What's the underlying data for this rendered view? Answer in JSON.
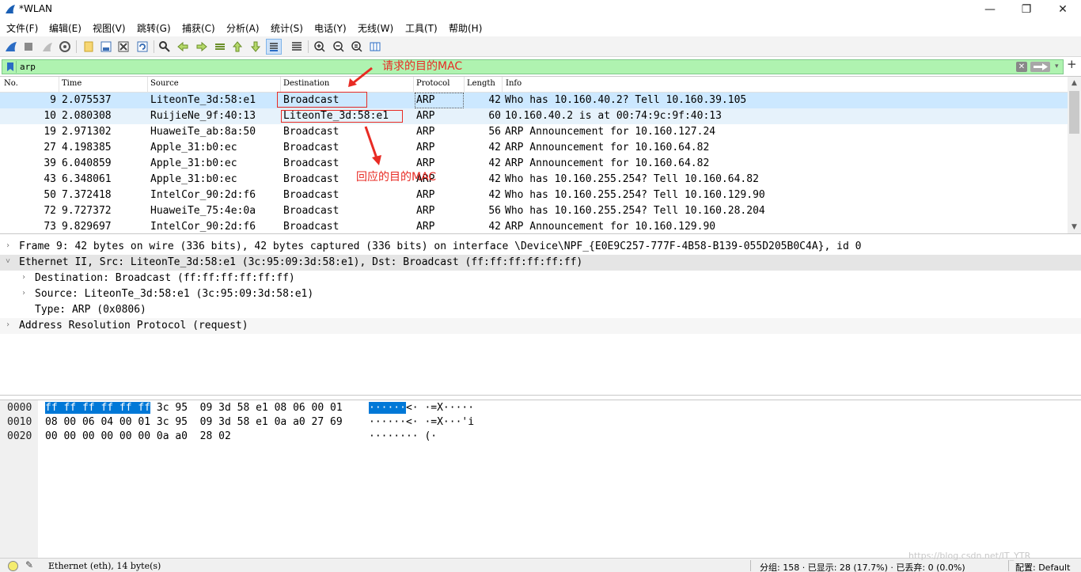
{
  "window": {
    "title": "*WLAN",
    "minimize": "—",
    "maximize": "❐",
    "close": "✕"
  },
  "menu": [
    "文件(F)",
    "编辑(E)",
    "视图(V)",
    "跳转(G)",
    "捕获(C)",
    "分析(A)",
    "统计(S)",
    "电话(Y)",
    "无线(W)",
    "工具(T)",
    "帮助(H)"
  ],
  "toolbar": {
    "icons": [
      "shark-start-icon",
      "stop-icon",
      "restart-icon",
      "options-gear-icon",
      "open-folder-icon",
      "save-file-icon",
      "close-file-icon",
      "reload-icon",
      "find-icon",
      "go-back-icon",
      "go-forward-icon",
      "go-to-packet-icon",
      "go-first-icon",
      "go-last-icon",
      "autoscroll-icon",
      "colorize-icon",
      "zoom-in-icon",
      "zoom-out-icon",
      "zoom-normal-icon",
      "resize-columns-icon"
    ]
  },
  "filter": {
    "value": "arp",
    "clear": "✕",
    "dropdown": "▾",
    "add": "+"
  },
  "packet_list": {
    "columns": [
      "No.",
      "Time",
      "Source",
      "Destination",
      "Protocol",
      "Length",
      "Info"
    ],
    "rows": [
      {
        "no": "9",
        "time": "2.075537",
        "source": "LiteonTe_3d:58:e1",
        "destination": "Broadcast",
        "protocol": "ARP",
        "length": "42",
        "info": "Who has 10.160.40.2? Tell 10.160.39.105"
      },
      {
        "no": "10",
        "time": "2.080308",
        "source": "RuijieNe_9f:40:13",
        "destination": "LiteonTe_3d:58:e1",
        "protocol": "ARP",
        "length": "60",
        "info": "10.160.40.2 is at 00:74:9c:9f:40:13"
      },
      {
        "no": "19",
        "time": "2.971302",
        "source": "HuaweiTe_ab:8a:50",
        "destination": "Broadcast",
        "protocol": "ARP",
        "length": "56",
        "info": "ARP Announcement for 10.160.127.24"
      },
      {
        "no": "27",
        "time": "4.198385",
        "source": "Apple_31:b0:ec",
        "destination": "Broadcast",
        "protocol": "ARP",
        "length": "42",
        "info": "ARP Announcement for 10.160.64.82"
      },
      {
        "no": "39",
        "time": "6.040859",
        "source": "Apple_31:b0:ec",
        "destination": "Broadcast",
        "protocol": "ARP",
        "length": "42",
        "info": "ARP Announcement for 10.160.64.82"
      },
      {
        "no": "43",
        "time": "6.348061",
        "source": "Apple_31:b0:ec",
        "destination": "Broadcast",
        "protocol": "ARP",
        "length": "42",
        "info": "Who has 10.160.255.254? Tell 10.160.64.82"
      },
      {
        "no": "50",
        "time": "7.372418",
        "source": "IntelCor_90:2d:f6",
        "destination": "Broadcast",
        "protocol": "ARP",
        "length": "42",
        "info": "Who has 10.160.255.254? Tell 10.160.129.90"
      },
      {
        "no": "72",
        "time": "9.727372",
        "source": "HuaweiTe_75:4e:0a",
        "destination": "Broadcast",
        "protocol": "ARP",
        "length": "56",
        "info": "Who has 10.160.255.254? Tell 10.160.28.204"
      },
      {
        "no": "73",
        "time": "9.829697",
        "source": "IntelCor_90:2d:f6",
        "destination": "Broadcast",
        "protocol": "ARP",
        "length": "42",
        "info": "ARP Announcement for 10.160.129.90"
      }
    ]
  },
  "details": [
    {
      "text": "Frame 9: 42 bytes on wire (336 bits), 42 bytes captured (336 bits) on interface \\Device\\NPF_{E0E9C257-777F-4B58-B139-055D205B0C4A}, id 0",
      "chev": "›"
    },
    {
      "text": "Ethernet II, Src: LiteonTe_3d:58:e1 (3c:95:09:3d:58:e1), Dst: Broadcast (ff:ff:ff:ff:ff:ff)",
      "chev": "˅"
    },
    {
      "text": "Destination: Broadcast (ff:ff:ff:ff:ff:ff)",
      "chev": "›"
    },
    {
      "text": "Source: LiteonTe_3d:58:e1 (3c:95:09:3d:58:e1)",
      "chev": "›"
    },
    {
      "text": "Type: ARP (0x0806)",
      "chev": ""
    },
    {
      "text": "Address Resolution Protocol (request)",
      "chev": "›"
    }
  ],
  "bytes": {
    "offsets": [
      "0000",
      "0010",
      "0020"
    ],
    "row0_hl": "ff ff ff ff ff ff",
    "row0_rest": " 3c 95  09 3d 58 e1 08 06 00 01",
    "row1_hex": "08 00 06 04 00 01 3c 95  09 3d 58 e1 0a a0 27 69",
    "row2_hex": "00 00 00 00 00 00 0a a0  28 02",
    "row0_ascii_hl": "······",
    "row0_ascii_rest": "<· ·=X·····",
    "row1_ascii": "······<· ·=X···'i",
    "row2_ascii": "········ (·"
  },
  "status": {
    "left": "Ethernet (eth), 14 byte(s)",
    "packets": "分组: 158 · 已显示: 28 (17.7%) · 已丢弃: 0 (0.0%)",
    "profile": "配置: Default"
  },
  "annotations": {
    "request_dst": "请求的目的MAC",
    "reply_dst": "回应的目的MAC"
  },
  "watermark": "https://blog.csdn.net/IT_YTR",
  "colors": {
    "selected_row": "#cce8ff",
    "filter_bg": "#aff3b0",
    "annotation": "#e82b24",
    "byte_highlight": "#0078d7"
  }
}
